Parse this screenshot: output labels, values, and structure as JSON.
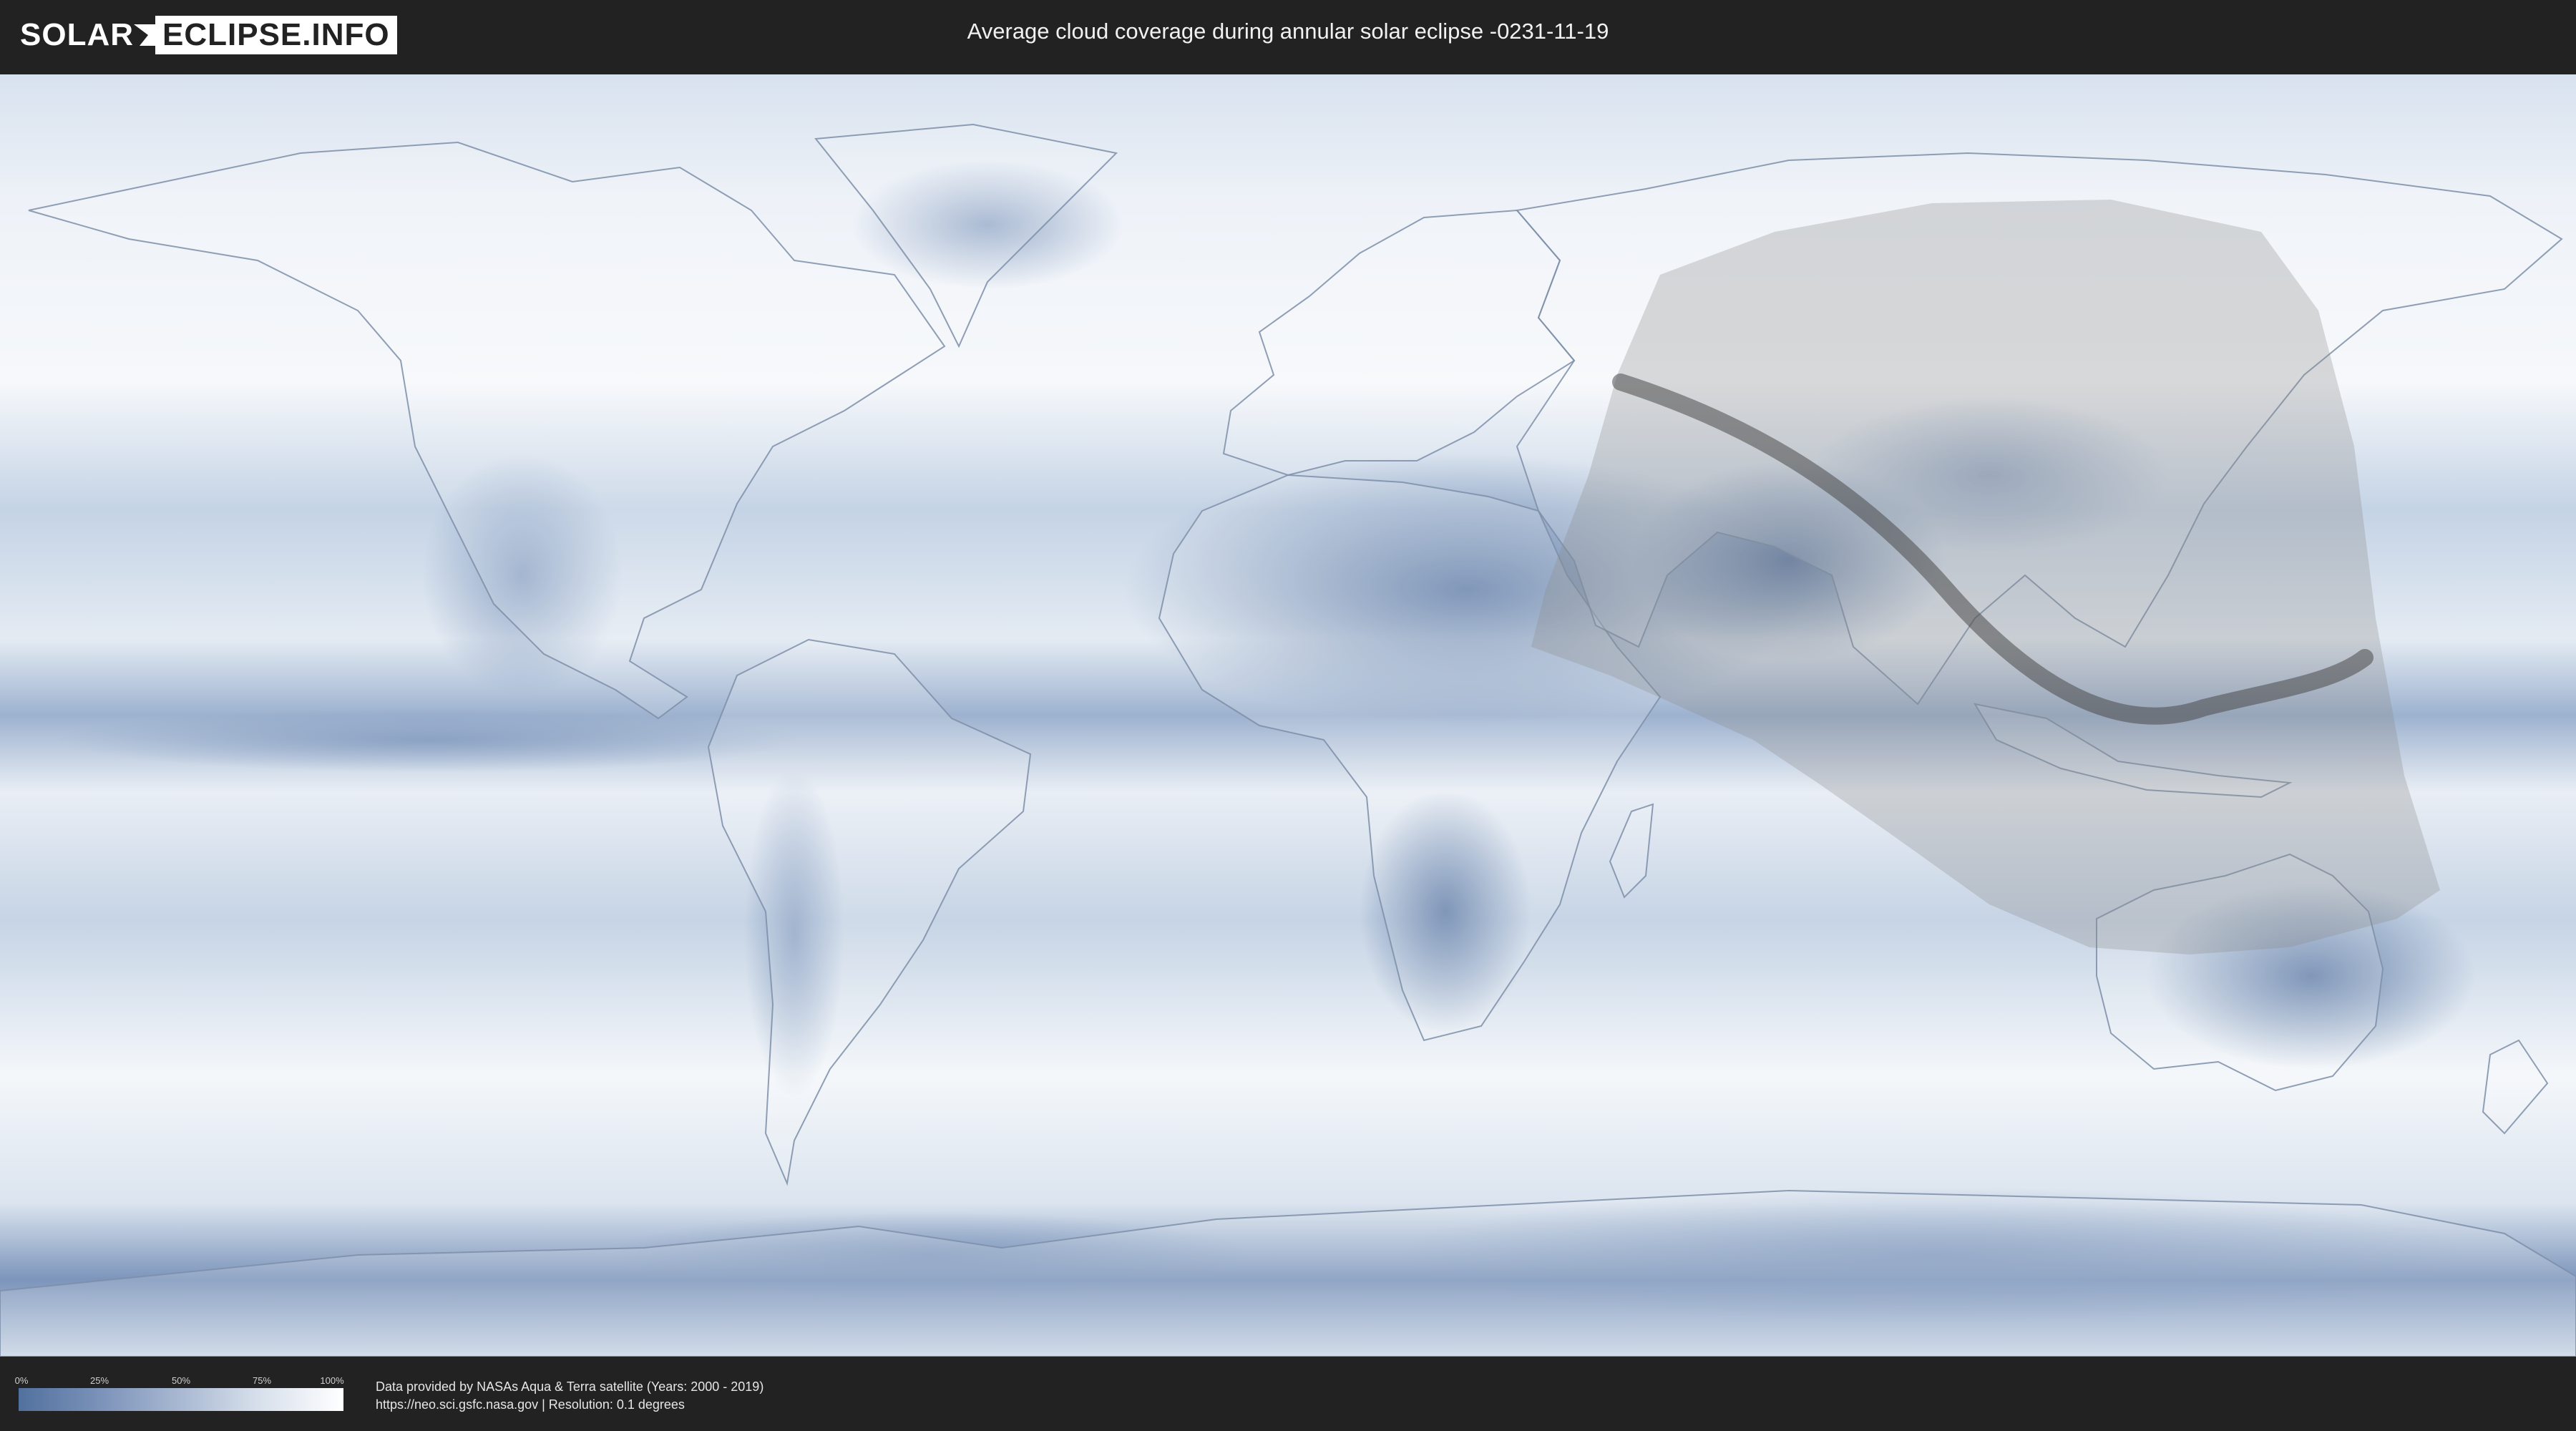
{
  "header": {
    "logo_left": "SOLAR",
    "logo_right": "ECLIPSE.INFO",
    "title": "Average cloud coverage during annular solar eclipse -0231-11-19"
  },
  "map": {
    "colors": {
      "clear_sky": "#51719e",
      "cloudy": "#ffffff",
      "background": "#222222",
      "eclipse_zone": "#8a8a8a",
      "central_path": "#4a4a4a"
    }
  },
  "legend": {
    "ticks": [
      "0%",
      "25%",
      "50%",
      "75%",
      "100%"
    ]
  },
  "footer": {
    "credit_line1": "Data provided by NASAs Aqua & Terra satellite (Years: 2000 - 2019)",
    "credit_line2": "https://neo.sci.gsfc.nasa.gov | Resolution: 0.1 degrees"
  }
}
